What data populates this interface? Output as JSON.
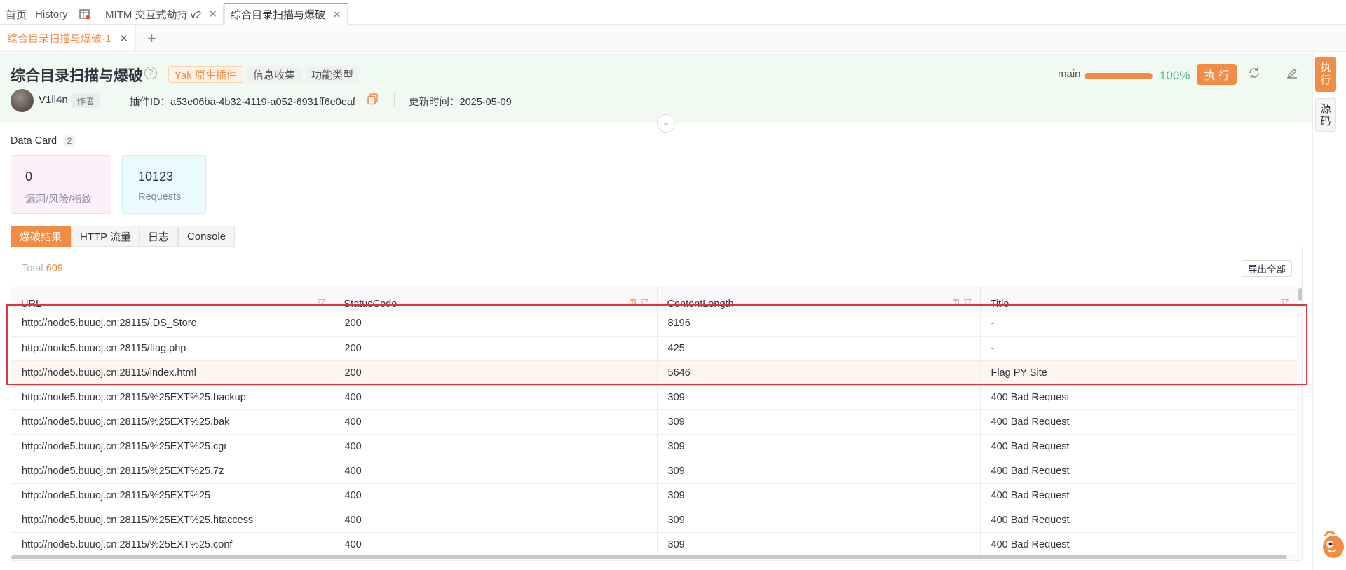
{
  "top_tabs": [
    {
      "label": "首页"
    },
    {
      "label": "History"
    },
    {
      "label": "MITM 交互式劫持 v2"
    },
    {
      "label": "综合目录扫描与爆破"
    }
  ],
  "sub_tab": {
    "label": "综合目录扫描与爆破-1"
  },
  "plugin": {
    "title": "综合目录扫描与爆破",
    "tags": [
      "Yak 原生插件",
      "信息收集",
      "功能类型"
    ],
    "author": "V1ll4n",
    "author_badge": "作者",
    "plugin_id": "插件ID：a53e06ba-4b32-4119-a052-6931ff6e0eaf",
    "updated": "更新时间：2025-05-09",
    "branch": "main",
    "progress_percent": 100,
    "progress_text": "100%",
    "exec_button": "执 行"
  },
  "side": {
    "exec": "执行",
    "source": "源码"
  },
  "data_card": {
    "title": "Data Card",
    "count": "2",
    "cards": [
      {
        "value": "0",
        "label": "漏洞/风险/指纹",
        "color": "#fdf0fb",
        "border": "#f7d7f2"
      },
      {
        "value": "10123",
        "label": "Requests",
        "color": "#ebfafc",
        "border": "#cdeff5"
      }
    ]
  },
  "result_tabs": [
    "爆破结果",
    "HTTP 流量",
    "日志",
    "Console"
  ],
  "table": {
    "total_label": "Total",
    "total_value": "609",
    "export_button": "导出全部",
    "columns": [
      "URL",
      "StatusCode",
      "ContentLength",
      "Title"
    ],
    "rows": [
      [
        "http://node5.buuoj.cn:28115/.DS_Store",
        "200",
        "8196",
        "-"
      ],
      [
        "http://node5.buuoj.cn:28115/flag.php",
        "200",
        "425",
        "-"
      ],
      [
        "http://node5.buuoj.cn:28115/index.html",
        "200",
        "5646",
        "Flag PY Site"
      ],
      [
        "http://node5.buuoj.cn:28115/%25EXT%25.backup",
        "400",
        "309",
        "400 Bad Request"
      ],
      [
        "http://node5.buuoj.cn:28115/%25EXT%25.bak",
        "400",
        "309",
        "400 Bad Request"
      ],
      [
        "http://node5.buuoj.cn:28115/%25EXT%25.cgi",
        "400",
        "309",
        "400 Bad Request"
      ],
      [
        "http://node5.buuoj.cn:28115/%25EXT%25.7z",
        "400",
        "309",
        "400 Bad Request"
      ],
      [
        "http://node5.buuoj.cn:28115/%25EXT%25",
        "400",
        "309",
        "400 Bad Request"
      ],
      [
        "http://node5.buuoj.cn:28115/%25EXT%25.htaccess",
        "400",
        "309",
        "400 Bad Request"
      ],
      [
        "http://node5.buuoj.cn:28115/%25EXT%25.conf",
        "400",
        "309",
        "400 Bad Request"
      ]
    ]
  },
  "colors": {
    "accent": "#f28b44",
    "success": "#4cbf8f",
    "highlight_box": "#d9363e"
  }
}
